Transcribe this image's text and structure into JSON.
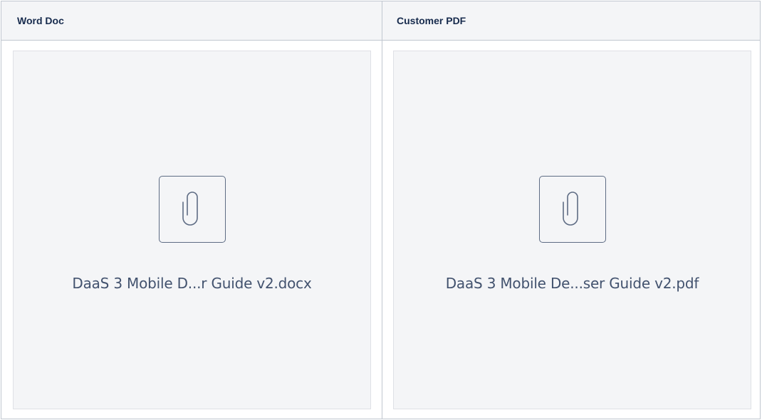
{
  "table": {
    "headers": [
      "Word Doc",
      "Customer PDF"
    ],
    "attachments": [
      {
        "file_name": "DaaS 3 Mobile D...r Guide v2.docx",
        "icon": "paperclip-icon"
      },
      {
        "file_name": "DaaS 3 Mobile De...ser Guide v2.pdf",
        "icon": "paperclip-icon"
      }
    ]
  },
  "colors": {
    "header_background": "#f4f5f7",
    "border": "#c1c7d0",
    "card_background": "#f4f5f7",
    "icon_stroke": "#5e6c84",
    "file_name_text": "#42526e"
  }
}
